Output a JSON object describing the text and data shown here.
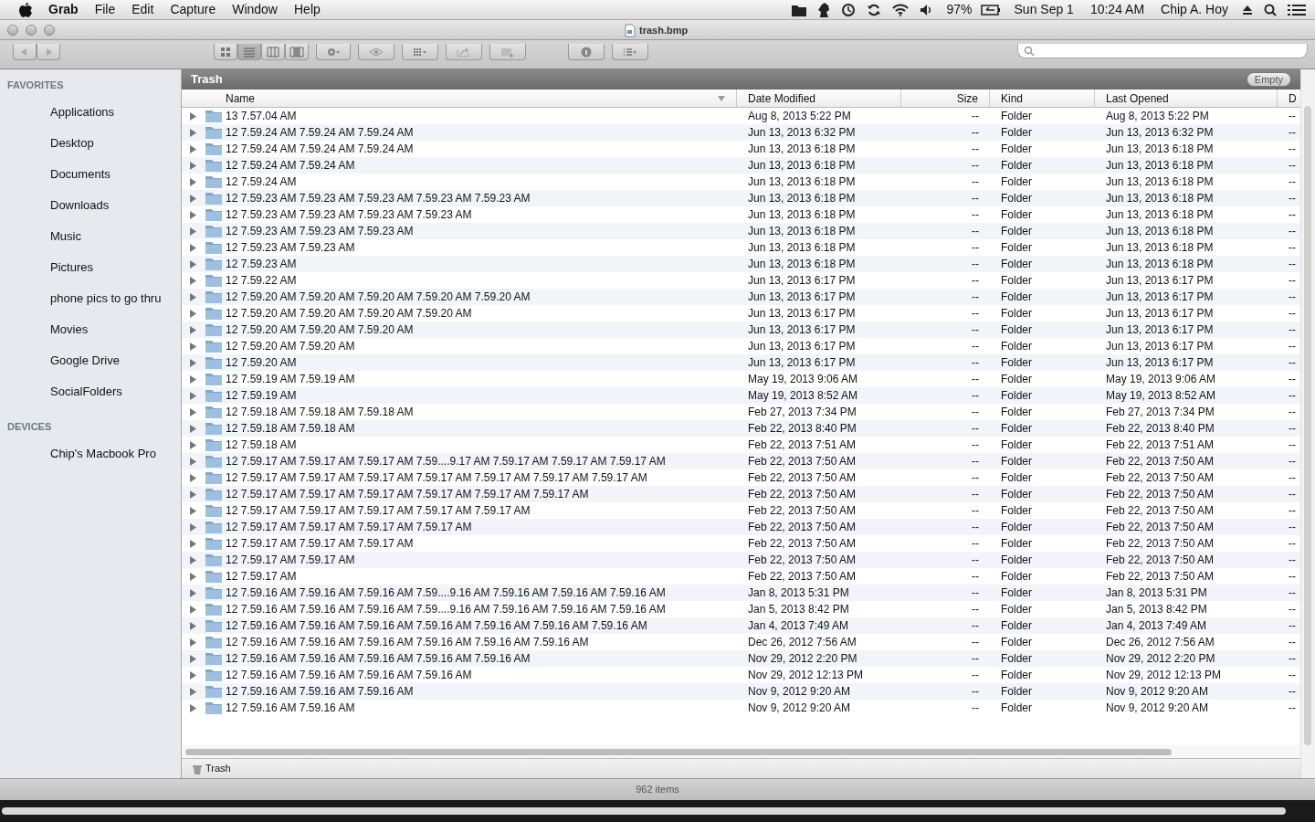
{
  "menu_bar": {
    "app": "Grab",
    "menus": [
      "File",
      "Edit",
      "Capture",
      "Window",
      "Help"
    ],
    "battery": "97%",
    "date": "Sun Sep 1",
    "time": "10:24 AM",
    "user": "Chip A. Hoy"
  },
  "window": {
    "title": "trash.bmp"
  },
  "sidebar": [
    {
      "heading": "FAVORITES",
      "items": [
        {
          "label": "Applications"
        },
        {
          "label": "Desktop"
        },
        {
          "label": "Documents"
        },
        {
          "label": "Downloads"
        },
        {
          "label": "Music"
        },
        {
          "label": "Pictures"
        },
        {
          "label": "phone pics to go thru"
        },
        {
          "label": "Movies"
        },
        {
          "label": "Google Drive"
        },
        {
          "label": "SocialFolders"
        }
      ]
    },
    {
      "heading": "DEVICES",
      "items": [
        {
          "label": "Chip's Macbook Pro"
        }
      ]
    }
  ],
  "folder": {
    "title": "Trash",
    "empty_button": "Empty"
  },
  "table": {
    "columns": [
      "Name",
      "Date Modified",
      "Size",
      "Kind",
      "Last Opened",
      "D"
    ],
    "rows": [
      {
        "name": "13 7.57.04 AM",
        "modified": "Aug 8, 2013 5:22 PM",
        "size": "--",
        "kind": "Folder",
        "opened": "Aug 8, 2013 5:22 PM",
        "column_6": "--"
      },
      {
        "name": "12 7.59.24 AM 7.59.24 AM 7.59.24 AM",
        "modified": "Jun 13, 2013 6:32 PM",
        "size": "--",
        "kind": "Folder",
        "opened": "Jun 13, 2013 6:32 PM",
        "column_6": "--"
      },
      {
        "name": "12 7.59.24 AM 7.59.24 AM 7.59.24 AM",
        "modified": "Jun 13, 2013 6:18 PM",
        "size": "--",
        "kind": "Folder",
        "opened": "Jun 13, 2013 6:18 PM",
        "column_6": "--"
      },
      {
        "name": "12 7.59.24 AM 7.59.24 AM",
        "modified": "Jun 13, 2013 6:18 PM",
        "size": "--",
        "kind": "Folder",
        "opened": "Jun 13, 2013 6:18 PM",
        "column_6": "--"
      },
      {
        "name": "12 7.59.24 AM",
        "modified": "Jun 13, 2013 6:18 PM",
        "size": "--",
        "kind": "Folder",
        "opened": "Jun 13, 2013 6:18 PM",
        "column_6": "--"
      },
      {
        "name": "12 7.59.23 AM 7.59.23 AM 7.59.23 AM 7.59.23 AM 7.59.23 AM",
        "modified": "Jun 13, 2013 6:18 PM",
        "size": "--",
        "kind": "Folder",
        "opened": "Jun 13, 2013 6:18 PM",
        "column_6": "--"
      },
      {
        "name": "12 7.59.23 AM 7.59.23 AM 7.59.23 AM 7.59.23 AM",
        "modified": "Jun 13, 2013 6:18 PM",
        "size": "--",
        "kind": "Folder",
        "opened": "Jun 13, 2013 6:18 PM",
        "column_6": "--"
      },
      {
        "name": "12 7.59.23 AM 7.59.23 AM 7.59.23 AM",
        "modified": "Jun 13, 2013 6:18 PM",
        "size": "--",
        "kind": "Folder",
        "opened": "Jun 13, 2013 6:18 PM",
        "column_6": "--"
      },
      {
        "name": "12 7.59.23 AM 7.59.23 AM",
        "modified": "Jun 13, 2013 6:18 PM",
        "size": "--",
        "kind": "Folder",
        "opened": "Jun 13, 2013 6:18 PM",
        "column_6": "--"
      },
      {
        "name": "12 7.59.23 AM",
        "modified": "Jun 13, 2013 6:18 PM",
        "size": "--",
        "kind": "Folder",
        "opened": "Jun 13, 2013 6:18 PM",
        "column_6": "--"
      },
      {
        "name": "12 7.59.22 AM",
        "modified": "Jun 13, 2013 6:17 PM",
        "size": "--",
        "kind": "Folder",
        "opened": "Jun 13, 2013 6:17 PM",
        "column_6": "--"
      },
      {
        "name": "12 7.59.20 AM 7.59.20 AM 7.59.20 AM 7.59.20 AM 7.59.20 AM",
        "modified": "Jun 13, 2013 6:17 PM",
        "size": "--",
        "kind": "Folder",
        "opened": "Jun 13, 2013 6:17 PM",
        "column_6": "--"
      },
      {
        "name": "12 7.59.20 AM 7.59.20 AM 7.59.20 AM 7.59.20 AM",
        "modified": "Jun 13, 2013 6:17 PM",
        "size": "--",
        "kind": "Folder",
        "opened": "Jun 13, 2013 6:17 PM",
        "column_6": "--"
      },
      {
        "name": "12 7.59.20 AM 7.59.20 AM 7.59.20 AM",
        "modified": "Jun 13, 2013 6:17 PM",
        "size": "--",
        "kind": "Folder",
        "opened": "Jun 13, 2013 6:17 PM",
        "column_6": "--"
      },
      {
        "name": "12 7.59.20 AM 7.59.20 AM",
        "modified": "Jun 13, 2013 6:17 PM",
        "size": "--",
        "kind": "Folder",
        "opened": "Jun 13, 2013 6:17 PM",
        "column_6": "--"
      },
      {
        "name": "12 7.59.20 AM",
        "modified": "Jun 13, 2013 6:17 PM",
        "size": "--",
        "kind": "Folder",
        "opened": "Jun 13, 2013 6:17 PM",
        "column_6": "--"
      },
      {
        "name": "12 7.59.19 AM 7.59.19 AM",
        "modified": "May 19, 2013 9:06 AM",
        "size": "--",
        "kind": "Folder",
        "opened": "May 19, 2013 9:06 AM",
        "column_6": "--"
      },
      {
        "name": "12 7.59.19 AM",
        "modified": "May 19, 2013 8:52 AM",
        "size": "--",
        "kind": "Folder",
        "opened": "May 19, 2013 8:52 AM",
        "column_6": "--"
      },
      {
        "name": "12 7.59.18 AM 7.59.18 AM 7.59.18 AM",
        "modified": "Feb 27, 2013 7:34 PM",
        "size": "--",
        "kind": "Folder",
        "opened": "Feb 27, 2013 7:34 PM",
        "column_6": "--"
      },
      {
        "name": "12 7.59.18 AM 7.59.18 AM",
        "modified": "Feb 22, 2013 8:40 PM",
        "size": "--",
        "kind": "Folder",
        "opened": "Feb 22, 2013 8:40 PM",
        "column_6": "--"
      },
      {
        "name": "12 7.59.18 AM",
        "modified": "Feb 22, 2013 7:51 AM",
        "size": "--",
        "kind": "Folder",
        "opened": "Feb 22, 2013 7:51 AM",
        "column_6": "--"
      },
      {
        "name": "12 7.59.17 AM 7.59.17 AM 7.59.17 AM 7.59....9.17 AM 7.59.17 AM 7.59.17 AM 7.59.17 AM",
        "modified": "Feb 22, 2013 7:50 AM",
        "size": "--",
        "kind": "Folder",
        "opened": "Feb 22, 2013 7:50 AM",
        "column_6": "--"
      },
      {
        "name": "12 7.59.17 AM 7.59.17 AM 7.59.17 AM 7.59.17 AM 7.59.17 AM 7.59.17 AM 7.59.17 AM",
        "modified": "Feb 22, 2013 7:50 AM",
        "size": "--",
        "kind": "Folder",
        "opened": "Feb 22, 2013 7:50 AM",
        "column_6": "--"
      },
      {
        "name": "12 7.59.17 AM 7.59.17 AM 7.59.17 AM 7.59.17 AM 7.59.17 AM 7.59.17 AM",
        "modified": "Feb 22, 2013 7:50 AM",
        "size": "--",
        "kind": "Folder",
        "opened": "Feb 22, 2013 7:50 AM",
        "column_6": "--"
      },
      {
        "name": "12 7.59.17 AM 7.59.17 AM 7.59.17 AM 7.59.17 AM 7.59.17 AM",
        "modified": "Feb 22, 2013 7:50 AM",
        "size": "--",
        "kind": "Folder",
        "opened": "Feb 22, 2013 7:50 AM",
        "column_6": "--"
      },
      {
        "name": "12 7.59.17 AM 7.59.17 AM 7.59.17 AM 7.59.17 AM",
        "modified": "Feb 22, 2013 7:50 AM",
        "size": "--",
        "kind": "Folder",
        "opened": "Feb 22, 2013 7:50 AM",
        "column_6": "--"
      },
      {
        "name": "12 7.59.17 AM 7.59.17 AM 7.59.17 AM",
        "modified": "Feb 22, 2013 7:50 AM",
        "size": "--",
        "kind": "Folder",
        "opened": "Feb 22, 2013 7:50 AM",
        "column_6": "--"
      },
      {
        "name": "12 7.59.17 AM 7.59.17 AM",
        "modified": "Feb 22, 2013 7:50 AM",
        "size": "--",
        "kind": "Folder",
        "opened": "Feb 22, 2013 7:50 AM",
        "column_6": "--"
      },
      {
        "name": "12 7.59.17 AM",
        "modified": "Feb 22, 2013 7:50 AM",
        "size": "--",
        "kind": "Folder",
        "opened": "Feb 22, 2013 7:50 AM",
        "column_6": "--"
      },
      {
        "name": "12 7.59.16 AM 7.59.16 AM 7.59.16 AM 7.59....9.16 AM 7.59.16 AM 7.59.16 AM 7.59.16 AM",
        "modified": "Jan 8, 2013 5:31 PM",
        "size": "--",
        "kind": "Folder",
        "opened": "Jan 8, 2013 5:31 PM",
        "column_6": "--"
      },
      {
        "name": "12 7.59.16 AM 7.59.16 AM 7.59.16 AM 7.59....9.16 AM 7.59.16 AM 7.59.16 AM 7.59.16 AM",
        "modified": "Jan 5, 2013 8:42 PM",
        "size": "--",
        "kind": "Folder",
        "opened": "Jan 5, 2013 8:42 PM",
        "column_6": "--"
      },
      {
        "name": "12 7.59.16 AM 7.59.16 AM 7.59.16 AM 7.59.16 AM 7.59.16 AM 7.59.16 AM 7.59.16 AM",
        "modified": "Jan 4, 2013 7:49 AM",
        "size": "--",
        "kind": "Folder",
        "opened": "Jan 4, 2013 7:49 AM",
        "column_6": "--"
      },
      {
        "name": "12 7.59.16 AM 7.59.16 AM 7.59.16 AM 7.59.16 AM 7.59.16 AM 7.59.16 AM",
        "modified": "Dec 26, 2012 7:56 AM",
        "size": "--",
        "kind": "Folder",
        "opened": "Dec 26, 2012 7:56 AM",
        "column_6": "--"
      },
      {
        "name": "12 7.59.16 AM 7.59.16 AM 7.59.16 AM 7.59.16 AM 7.59.16 AM",
        "modified": "Nov 29, 2012 2:20 PM",
        "size": "--",
        "kind": "Folder",
        "opened": "Nov 29, 2012 2:20 PM",
        "column_6": "--"
      },
      {
        "name": "12 7.59.16 AM 7.59.16 AM 7.59.16 AM 7.59.16 AM",
        "modified": "Nov 29, 2012 12:13 PM",
        "size": "--",
        "kind": "Folder",
        "opened": "Nov 29, 2012 12:13 PM",
        "column_6": "--"
      },
      {
        "name": "12 7.59.16 AM 7.59.16 AM 7.59.16 AM",
        "modified": "Nov 9, 2012 9:20 AM",
        "size": "--",
        "kind": "Folder",
        "opened": "Nov 9, 2012 9:20 AM",
        "column_6": "--"
      },
      {
        "name": "12 7.59.16 AM 7.59.16 AM",
        "modified": "Nov 9, 2012 9:20 AM",
        "size": "--",
        "kind": "Folder",
        "opened": "Nov 9, 2012 9:20 AM",
        "column_6": "--"
      }
    ]
  },
  "path_bar": {
    "item": "Trash"
  },
  "status_bar": "962 items"
}
